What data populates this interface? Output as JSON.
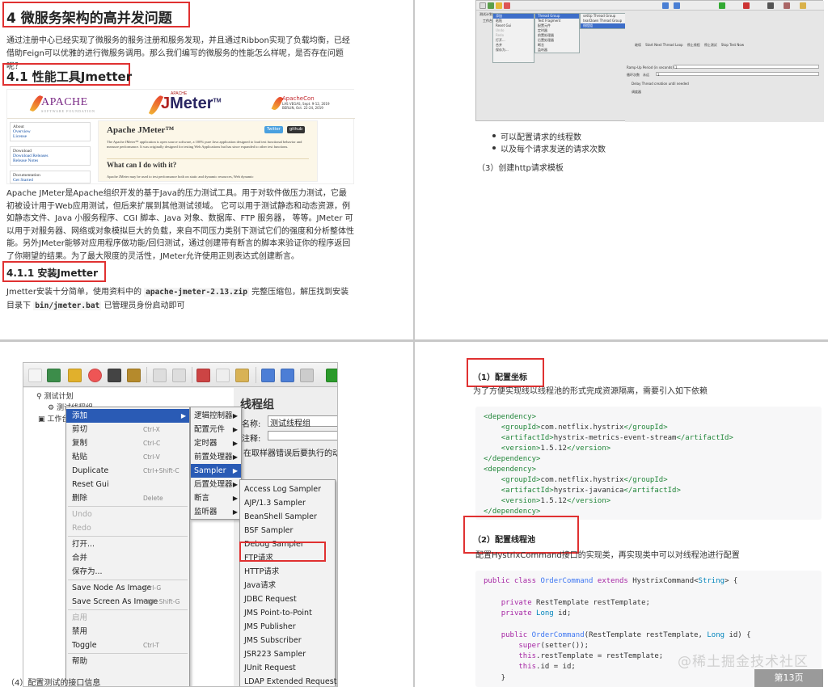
{
  "p1": {
    "h1": "4 微服务架构的高并发问题",
    "intro": "通过注册中心已经实现了微服务的服务注册和服务发现，并且通过Ribbon实现了负载均衡，已经借助Feign可以优雅的进行微服务调用。那么我们编写的微服务的性能怎么样呢，是否存在问题呢？",
    "h2": "4.1 性能工具Jmetter",
    "site": {
      "logo": "APACHE",
      "logo_sub": "SOFTWARE FOUNDATION",
      "product_small": "APACHE",
      "product_j": "J",
      "product_rest": "Meter",
      "tm": "TM",
      "con_title": "ApacheCon",
      "con_lines": [
        "LAS VEGAS, Sept. 9-12, 2019",
        "BERLIN, Oct. 22-24, 2019"
      ],
      "side_about": "About",
      "side_about_links": [
        "Overview",
        "License"
      ],
      "side_download": "Download",
      "side_download_links": [
        "Download Releases",
        "Release Notes"
      ],
      "side_doc": "Documentation",
      "side_doc_links": [
        "Get Started"
      ],
      "title": "Apache JMeter™",
      "btn_twitter": "Twitter",
      "btn_github": "github",
      "desc1": "The Apache JMeter™ application is open source software, a 100% pure Java application designed to load test functional behavior and measure performance. It was originally designed for testing Web Applications but has since expanded to other test functions.",
      "subtitle": "What can I do with it?",
      "desc2": "Apache JMeter may be used to test performance both on static and dynamic resources, Web dynamic"
    },
    "body": "Apache JMeter是Apache组织开发的基于Java的压力测试工具。用于对软件做压力测试，它最初被设计用于Web应用测试，但后来扩展到其他测试领域。 它可以用于测试静态和动态资源，例如静态文件、Java 小服务程序、CGI 脚本、Java 对象、数据库、FTP 服务器， 等等。JMeter 可以用于对服务器、网络或对象模拟巨大的负载，来自不同压力类别下测试它们的强度和分析整体性能。另外JMeter能够对应用程序做功能/回归测试，通过创建带有断言的脚本来验证你的程序返回了你期望的结果。为了最大限度的灵活性，JMeter允许使用正则表达式创建断言。",
    "h3": "4.1.1 安装Jmetter",
    "install_pre": "Jmetter安装十分简单，使用资料中的 ",
    "install_zip": "apache-jmeter-2.13.zip",
    "install_mid": " 完整压缩包，解压找到安装目录下 ",
    "install_bat": "bin/jmeter.bat",
    "install_post": " 已管理员身份启动即可"
  },
  "p2": {
    "menu1": [
      "添加",
      "粘贴",
      "Reset Gui",
      "",
      "Undo",
      "Redo",
      "",
      "打开...",
      "合并",
      "保存为..."
    ],
    "menu2": [
      "Thread Group",
      "Test Fragment",
      "配置元件",
      "定时器",
      "前置处理器",
      "后置处理器",
      "断言",
      "监听器"
    ],
    "menu3": [
      "setUp Thread Group",
      "tearDown Thread Group",
      "线程组"
    ],
    "tree": [
      "测试计划",
      "工作台"
    ],
    "radio": [
      "继续",
      "Start Next Thread Loop",
      "停止线程",
      "停止测试",
      "Stop Test Now"
    ],
    "ramp": "Ramp-Up Period (in seconds):",
    "ramp_val": "1",
    "loop": "循环次数",
    "loop_forever": "永远",
    "loop_val": "1",
    "delay": "Delay Thread creation until needed",
    "sched": "调度器",
    "bullets": [
      "可以配置请求的线程数",
      "以及每个请求发送的请求次数"
    ],
    "caption": "（3）创建http请求模板"
  },
  "p3": {
    "tree_plan": "测试计划",
    "tree_group": "测试线程组",
    "tree_work": "工作台",
    "panel_title": "线程组",
    "name_label": "名称:",
    "name_value": "测试线程组",
    "note_label": "注释:",
    "err_text": "在取样器错误后要执行的动",
    "ctx": [
      {
        "label": "添加",
        "sc": "",
        "hl": true,
        "arrow": true
      },
      {
        "label": "剪切",
        "sc": "Ctrl-X"
      },
      {
        "label": "复制",
        "sc": "Ctrl-C"
      },
      {
        "label": "粘贴",
        "sc": "Ctrl-V"
      },
      {
        "label": "Duplicate",
        "sc": "Ctrl+Shift-C"
      },
      {
        "label": "Reset Gui",
        "sc": ""
      },
      {
        "label": "删除",
        "sc": "Delete"
      },
      {
        "sep": true
      },
      {
        "label": "Undo",
        "sc": "",
        "dis": true
      },
      {
        "label": "Redo",
        "sc": "",
        "dis": true
      },
      {
        "sep": true
      },
      {
        "label": "打开...",
        "sc": ""
      },
      {
        "label": "合并",
        "sc": ""
      },
      {
        "label": "保存为...",
        "sc": ""
      },
      {
        "sep": true
      },
      {
        "label": "Save Node As Image",
        "sc": "Ctrl-G"
      },
      {
        "label": "Save Screen As Image",
        "sc": "Ctrl+Shift-G"
      },
      {
        "sep": true
      },
      {
        "label": "启用",
        "sc": "",
        "dis": true
      },
      {
        "label": "禁用",
        "sc": ""
      },
      {
        "label": "Toggle",
        "sc": "Ctrl-T"
      },
      {
        "sep": true
      },
      {
        "label": "帮助",
        "sc": ""
      }
    ],
    "sub": [
      {
        "label": "逻辑控制器",
        "hl": false
      },
      {
        "label": "配置元件",
        "hl": false
      },
      {
        "label": "定时器",
        "hl": false
      },
      {
        "label": "前置处理器",
        "hl": false
      },
      {
        "label": "Sampler",
        "hl": true
      },
      {
        "label": "后置处理器",
        "hl": false
      },
      {
        "label": "断言",
        "hl": false
      },
      {
        "label": "监听器",
        "hl": false
      }
    ],
    "samplers": [
      "Access Log Sampler",
      "AJP/1.3 Sampler",
      "BeanShell Sampler",
      "BSF Sampler",
      "Debug Sampler",
      "FTP请求",
      "HTTP请求",
      "Java请求",
      "JDBC Request",
      "JMS Point-to-Point",
      "JMS Publisher",
      "JMS Subscriber",
      "JSR223 Sampler",
      "JUnit Request",
      "LDAP Extended Request"
    ],
    "caption": "（4）配置测试的接口信息"
  },
  "p4": {
    "h_coord": "（1）配置坐标",
    "coord_desc": "为了方便实现线以线程池的形式完成资源隔离，需要引入如下依赖",
    "dep_code": [
      [
        [
          "tag",
          "<dependency>"
        ]
      ],
      [
        [
          "",
          "    "
        ],
        [
          "tag",
          "<groupId>"
        ],
        [
          "",
          "com.netflix.hystrix"
        ],
        [
          "tag",
          "</groupId>"
        ]
      ],
      [
        [
          "",
          "    "
        ],
        [
          "tag",
          "<artifactId>"
        ],
        [
          "",
          "hystrix-metrics-event-stream"
        ],
        [
          "tag",
          "</artifactId>"
        ]
      ],
      [
        [
          "",
          "    "
        ],
        [
          "tag",
          "<version>"
        ],
        [
          "",
          "1.5.12"
        ],
        [
          "tag",
          "</version>"
        ]
      ],
      [
        [
          "tag",
          "</dependency>"
        ]
      ],
      [
        [
          "tag",
          "<dependency>"
        ]
      ],
      [
        [
          "",
          "    "
        ],
        [
          "tag",
          "<groupId>"
        ],
        [
          "",
          "com.netflix.hystrix"
        ],
        [
          "tag",
          "</groupId>"
        ]
      ],
      [
        [
          "",
          "    "
        ],
        [
          "tag",
          "<artifactId>"
        ],
        [
          "",
          "hystrix-javanica"
        ],
        [
          "tag",
          "</artifactId>"
        ]
      ],
      [
        [
          "",
          "    "
        ],
        [
          "tag",
          "<version>"
        ],
        [
          "",
          "1.5.12"
        ],
        [
          "tag",
          "</version>"
        ]
      ],
      [
        [
          "tag",
          "</dependency>"
        ]
      ]
    ],
    "h_pool": "（2）配置线程池",
    "pool_desc": "配置HystrixCommand接口的实现类，再实现类中可以对线程池进行配置",
    "java_code": [
      [
        [
          "kw",
          "public class "
        ],
        [
          "fn",
          "OrderCommand "
        ],
        [
          "kw",
          "extends "
        ],
        [
          "",
          "HystrixCommand<"
        ],
        [
          "ty",
          "String"
        ],
        [
          "",
          "> {"
        ]
      ],
      [
        [
          "",
          ""
        ]
      ],
      [
        [
          "",
          "    "
        ],
        [
          "kw",
          "private "
        ],
        [
          "",
          "RestTemplate restTemplate;"
        ]
      ],
      [
        [
          "",
          "    "
        ],
        [
          "kw",
          "private "
        ],
        [
          "ty",
          "Long "
        ],
        [
          "",
          "id;"
        ]
      ],
      [
        [
          "",
          ""
        ]
      ],
      [
        [
          "",
          "    "
        ],
        [
          "kw",
          "public "
        ],
        [
          "fn",
          "OrderCommand"
        ],
        [
          "",
          "(RestTemplate restTemplate, "
        ],
        [
          "ty",
          "Long "
        ],
        [
          "",
          "id) {"
        ]
      ],
      [
        [
          "",
          "        "
        ],
        [
          "kw",
          "super"
        ],
        [
          "",
          "(setter());"
        ]
      ],
      [
        [
          "",
          "        "
        ],
        [
          "kw",
          "this"
        ],
        [
          "",
          ".restTemplate = restTemplate;"
        ]
      ],
      [
        [
          "",
          "        "
        ],
        [
          "kw",
          "this"
        ],
        [
          "",
          ".id = id;"
        ]
      ],
      [
        [
          "",
          "    }"
        ]
      ]
    ],
    "watermark": "@稀土掘金技术社区",
    "page": "第13页"
  }
}
